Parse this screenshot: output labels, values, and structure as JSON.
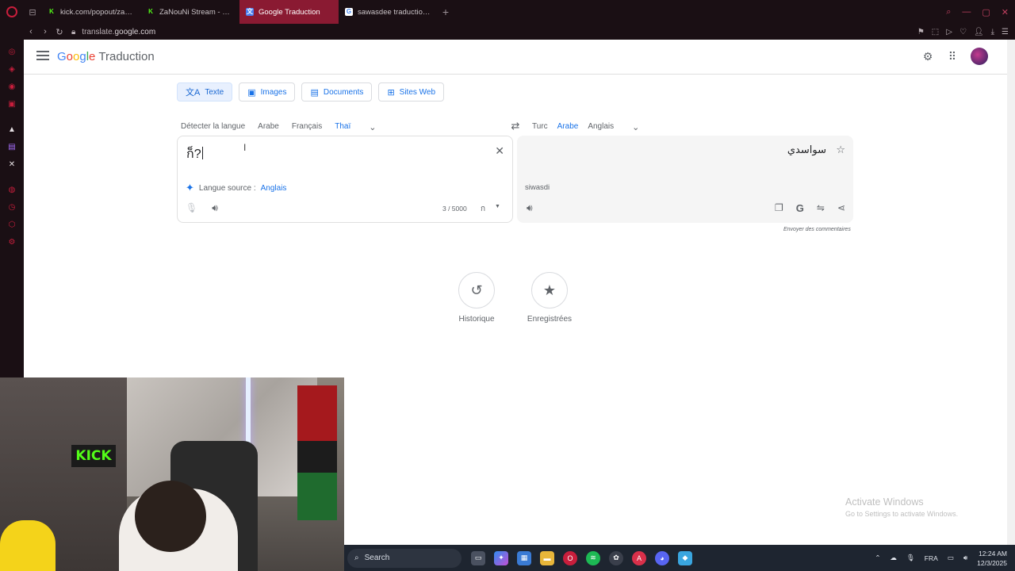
{
  "browser": {
    "tabs": [
      {
        "title": "kick.com/popout/zanoun",
        "favicon": "K",
        "favicon_style": "kick",
        "active": false
      },
      {
        "title": "ZaNouNi Stream - Watch",
        "favicon": "K",
        "favicon_style": "kick",
        "active": false
      },
      {
        "title": "Google Traduction",
        "favicon": "文",
        "favicon_style": "gt",
        "active": true
      },
      {
        "title": "sawasdee traduction - Re",
        "favicon": "G",
        "favicon_style": "google",
        "active": false
      }
    ],
    "new_tab": "+",
    "url_prefix": "translate.",
    "url_domain": "google.com",
    "accent_color": "#8a1a32"
  },
  "app": {
    "logo_google": [
      "G",
      "o",
      "o",
      "g",
      "l",
      "e"
    ],
    "product": "Traduction"
  },
  "modes": [
    {
      "label": "Texte",
      "icon": "文A",
      "active": true
    },
    {
      "label": "Images",
      "icon": "▣",
      "active": false
    },
    {
      "label": "Documents",
      "icon": "▤",
      "active": false
    },
    {
      "label": "Sites Web",
      "icon": "⊞",
      "active": false
    }
  ],
  "source_langs": [
    {
      "label": "Détecter la langue",
      "active": false
    },
    {
      "label": "Arabe",
      "active": false
    },
    {
      "label": "Français",
      "active": false
    },
    {
      "label": "Thaï",
      "active": true
    }
  ],
  "target_langs": [
    {
      "label": "Turc",
      "active": false
    },
    {
      "label": "Arabe",
      "active": true
    },
    {
      "label": "Anglais",
      "active": false
    }
  ],
  "source": {
    "text": "ก็?",
    "detected_prefix": "Langue source :",
    "detected_lang": "Anglais",
    "char_count": "3 / 5000"
  },
  "target": {
    "text": "سواسدي",
    "transliteration": "siwasdi",
    "feedback": "Envoyer des commentaires"
  },
  "quick_links": {
    "history": "Historique",
    "saved": "Enregistrées"
  },
  "watermark": {
    "line1": "Activate Windows",
    "line2": "Go to Settings to activate Windows."
  },
  "taskbar": {
    "search": "Search",
    "lang": "FRA",
    "time": "12:24 AM",
    "date": "12/3/2025"
  },
  "webcam": {
    "sign": "KICK"
  }
}
